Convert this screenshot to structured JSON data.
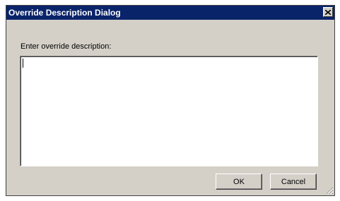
{
  "window": {
    "title": "Override Description Dialog"
  },
  "form": {
    "prompt_label": "Enter override description:",
    "description_value": ""
  },
  "buttons": {
    "ok_label": "OK",
    "cancel_label": "Cancel"
  },
  "icons": {
    "close": "close-icon",
    "resize_grip": "resize-grip-icon"
  },
  "colors": {
    "titlebar": "#0a246a",
    "title_text": "#ffffff",
    "dialog_face": "#d4d0c8",
    "text_area": "#ffffff"
  }
}
